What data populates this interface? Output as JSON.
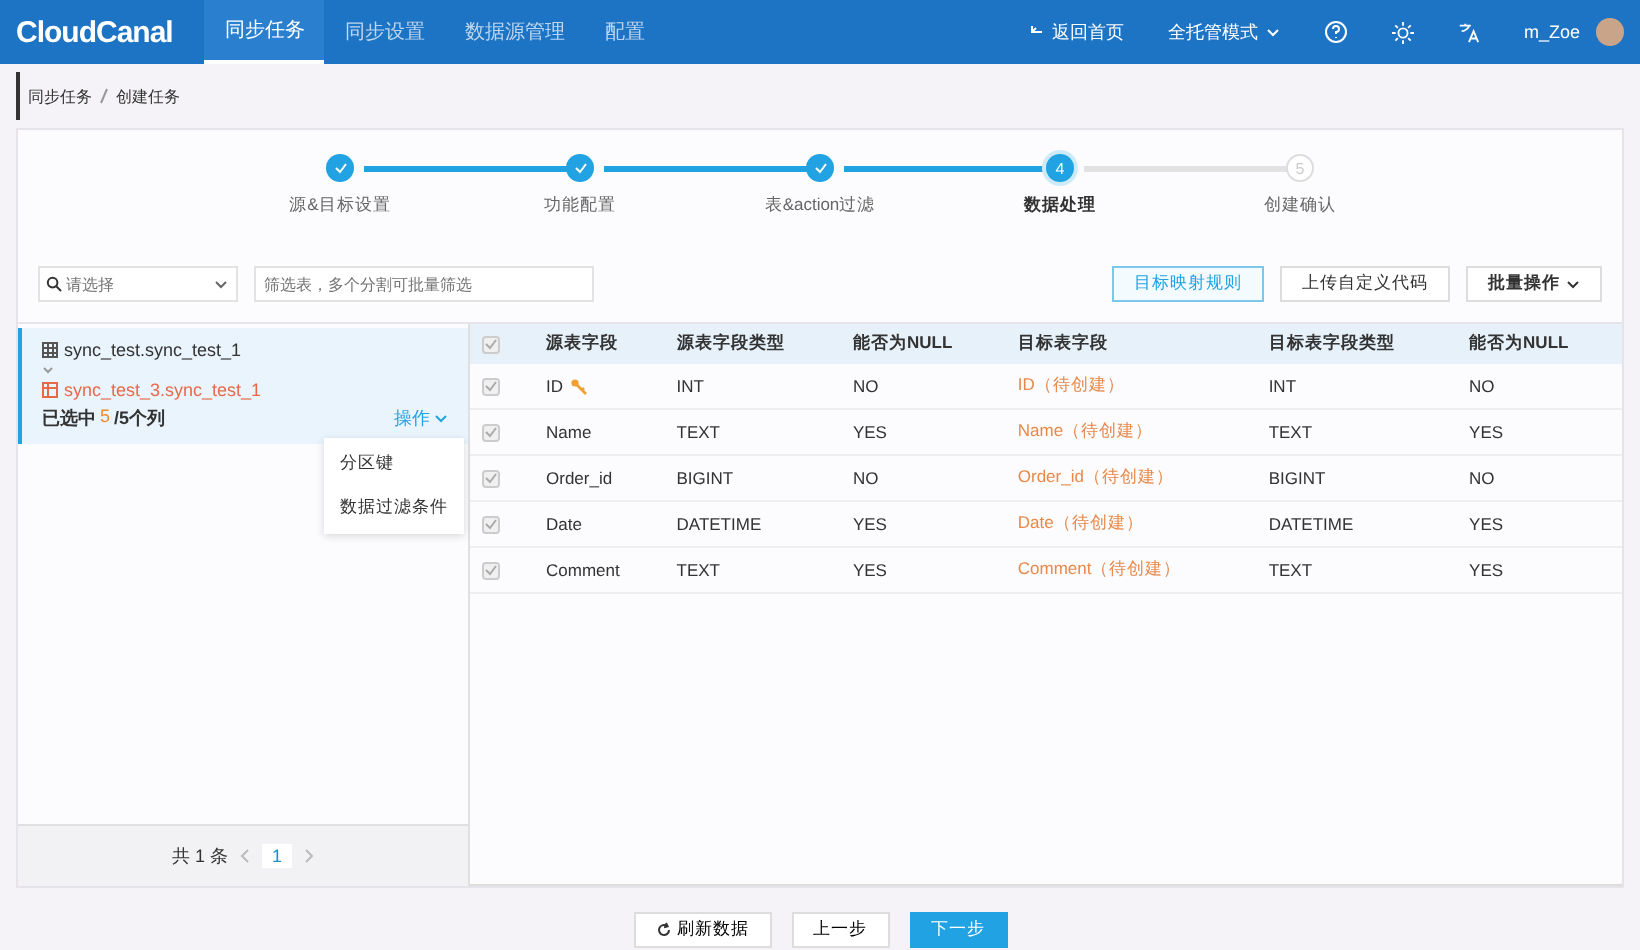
{
  "header": {
    "logo": "CloudCanal",
    "nav": [
      {
        "label": "同步任务",
        "selected": true
      },
      {
        "label": "同步设置",
        "selected": false
      },
      {
        "label": "数据源管理",
        "selected": false
      },
      {
        "label": "配置",
        "selected": false
      }
    ],
    "back": "返回首页",
    "mode": "全托管模式",
    "user": "m_Zoe"
  },
  "breadcrumb": [
    "同步任务",
    "创建任务"
  ],
  "steps": [
    {
      "label": "源&目标设置",
      "completed": true,
      "selected": false
    },
    {
      "label": "功能配置",
      "completed": true,
      "selected": false
    },
    {
      "label": "表&action过滤",
      "completed": true,
      "selected": false
    },
    {
      "label": "数据处理",
      "number": "4",
      "completed": false,
      "selected": true
    },
    {
      "label": "创建确认",
      "number": "5",
      "completed": false,
      "selected": false
    }
  ],
  "toolbar": {
    "select_placeholder": "请选择",
    "search_placeholder": "筛选表，多个分割可批量筛选",
    "buttons": [
      {
        "label": "目标映射规则",
        "kind": "primary"
      },
      {
        "label": "上传自定义代码",
        "kind": "plain"
      },
      {
        "label": "批量操作",
        "kind": "dropdown"
      }
    ]
  },
  "tables": [
    {
      "source": "sync_test.sync_test_1",
      "target": "sync_test_3.sync_test_1",
      "selected_label": "已选中",
      "selected_count": "5",
      "total": "/5个列",
      "action": "操作",
      "selected": true
    }
  ],
  "action_menu": [
    "分区键",
    "数据过滤条件"
  ],
  "pagination": {
    "total": "共 1 条",
    "pages": [
      {
        "label": "1",
        "selected": true
      }
    ]
  },
  "all_checked": true,
  "columns": [
    "源表字段",
    "源表字段类型",
    "能否为NULL",
    "目标表字段",
    "目标表字段类型",
    "能否为NULL"
  ],
  "rows": [
    {
      "checked": true,
      "primary_key": true,
      "cells": [
        "ID",
        "INT",
        "NO",
        "ID（待创建）",
        "INT",
        "NO"
      ]
    },
    {
      "checked": true,
      "primary_key": false,
      "cells": [
        "Name",
        "TEXT",
        "YES",
        "Name（待创建）",
        "TEXT",
        "YES"
      ]
    },
    {
      "checked": true,
      "primary_key": false,
      "cells": [
        "Order_id",
        "BIGINT",
        "NO",
        "Order_id（待创建）",
        "BIGINT",
        "NO"
      ]
    },
    {
      "checked": true,
      "primary_key": false,
      "cells": [
        "Date",
        "DATETIME",
        "YES",
        "Date（待创建）",
        "DATETIME",
        "YES"
      ]
    },
    {
      "checked": true,
      "primary_key": false,
      "cells": [
        "Comment",
        "TEXT",
        "YES",
        "Comment（待创建）",
        "TEXT",
        "YES"
      ]
    }
  ],
  "footer": [
    {
      "label": "刷新数据",
      "kind": "refresh"
    },
    {
      "label": "上一步",
      "kind": "plain"
    },
    {
      "label": "下一步",
      "kind": "primary"
    }
  ]
}
